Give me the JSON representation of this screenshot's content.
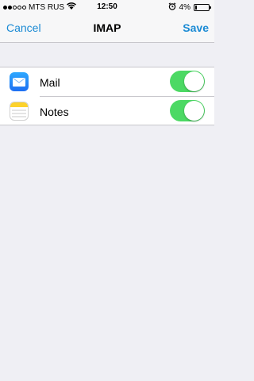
{
  "status_bar": {
    "carrier": "MTS RUS",
    "time": "12:50",
    "battery": "4%",
    "signal_strength": 2,
    "icons": [
      "signal-dots-icon",
      "wifi-icon",
      "alarm-icon",
      "battery-icon"
    ]
  },
  "nav": {
    "cancel_label": "Cancel",
    "title": "IMAP",
    "save_label": "Save"
  },
  "settings": {
    "items": [
      {
        "label": "Mail",
        "icon": "mail-app-icon",
        "enabled": true
      },
      {
        "label": "Notes",
        "icon": "notes-app-icon",
        "enabled": true
      }
    ]
  },
  "colors": {
    "accent": "#1a8ad4",
    "toggle_on": "#4cd964",
    "background": "#efeff4"
  }
}
